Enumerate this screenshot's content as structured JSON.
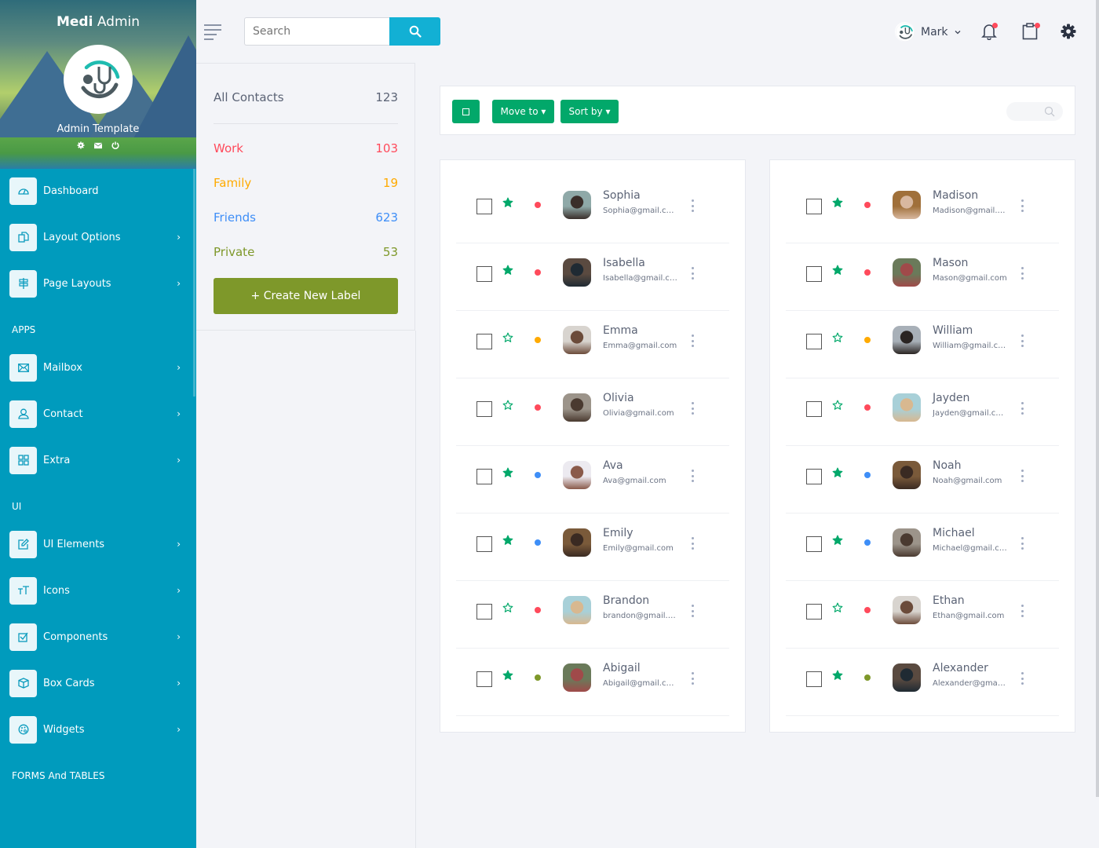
{
  "brand": {
    "bold": "Medi",
    "light": "Admin",
    "subtitle": "Admin Template"
  },
  "sidebar": {
    "header_icons": [
      "gear-icon",
      "mail-icon",
      "power-icon"
    ],
    "items": [
      {
        "label": "Dashboard",
        "icon": "speedometer-icon",
        "chevron": ""
      },
      {
        "label": "Layout Options",
        "icon": "copy-icon",
        "chevron": "›"
      },
      {
        "label": "Page Layouts",
        "icon": "signpost-icon",
        "chevron": "›"
      },
      {
        "label": "Mailbox",
        "icon": "envelope-icon",
        "chevron": "›"
      },
      {
        "label": "Contact",
        "icon": "user-icon",
        "chevron": "›"
      },
      {
        "label": "Extra",
        "icon": "grid-icon",
        "chevron": "›"
      },
      {
        "label": "UI Elements",
        "icon": "edit-icon",
        "chevron": "›"
      },
      {
        "label": "Icons",
        "icon": "text-size-icon",
        "chevron": "›"
      },
      {
        "label": "Components",
        "icon": "checkbox-icon",
        "chevron": "›"
      },
      {
        "label": "Box Cards",
        "icon": "box-icon",
        "chevron": "›"
      },
      {
        "label": "Widgets",
        "icon": "palette-icon",
        "chevron": "›"
      }
    ],
    "sections": [
      "APPS",
      "UI",
      "FORMS And TABLES"
    ]
  },
  "topbar": {
    "search_placeholder": "Search",
    "user_name": "Mark",
    "user_chevron": "⌄"
  },
  "labels": {
    "all": {
      "label": "All Contacts",
      "count": "123",
      "color": "#5b6375"
    },
    "items": [
      {
        "label": "Work",
        "count": "103",
        "color": "#ff4a5b"
      },
      {
        "label": "Family",
        "count": "19",
        "color": "#ffaa00"
      },
      {
        "label": "Friends",
        "count": "623",
        "color": "#3e8ef7"
      },
      {
        "label": "Private",
        "count": "53",
        "color": "#7e982a"
      }
    ],
    "create_button": "+ Create New Label"
  },
  "toolbar": {
    "select_all_glyph": "☐",
    "move_to": "Move to ▾",
    "sort_by": "Sort by ▾"
  },
  "colors": {
    "accent": "#009bbd",
    "green": "#02a86a",
    "red": "#ff4a5b",
    "orange": "#ffaa00",
    "blue": "#3e8ef7",
    "olive": "#7e982a"
  },
  "contacts": {
    "left": [
      {
        "name": "Sophia",
        "email": "Sophia@gmail.com",
        "starred": true,
        "status": "red",
        "avatar": [
          "#8fa9a8",
          "#3a2e2a"
        ]
      },
      {
        "name": "Isabella",
        "email": "Isabella@gmail.com",
        "starred": true,
        "status": "red",
        "avatar": [
          "#5a4a40",
          "#1f2a33"
        ]
      },
      {
        "name": "Emma",
        "email": "Emma@gmail.com",
        "starred": false,
        "status": "orange",
        "avatar": [
          "#d8d4cf",
          "#6b4b3a"
        ]
      },
      {
        "name": "Olivia",
        "email": "Olivia@gmail.com",
        "starred": false,
        "status": "red",
        "avatar": [
          "#9c948a",
          "#4a3a30"
        ]
      },
      {
        "name": "Ava",
        "email": "Ava@gmail.com",
        "starred": true,
        "status": "blue",
        "avatar": [
          "#eceaf0",
          "#8a5a4a"
        ]
      },
      {
        "name": "Emily",
        "email": "Emily@gmail.com",
        "starred": true,
        "status": "blue",
        "avatar": [
          "#7a5a3a",
          "#3a2a22"
        ]
      },
      {
        "name": "Brandon",
        "email": "brandon@gmail.com",
        "starred": false,
        "status": "red",
        "avatar": [
          "#a8d0d8",
          "#d8b890"
        ]
      },
      {
        "name": "Abigail",
        "email": "Abigail@gmail.com",
        "starred": true,
        "status": "olive",
        "avatar": [
          "#6a7a5a",
          "#a04a4a"
        ]
      }
    ],
    "right": [
      {
        "name": "Madison",
        "email": "Madison@gmail.com",
        "starred": true,
        "status": "red",
        "avatar": [
          "#a0703a",
          "#d8b8a0"
        ]
      },
      {
        "name": "Mason",
        "email": "Mason@gmail.com",
        "starred": true,
        "status": "red",
        "avatar": [
          "#6a7a5a",
          "#a04a4a"
        ]
      },
      {
        "name": "William",
        "email": "William@gmail.com",
        "starred": false,
        "status": "orange",
        "avatar": [
          "#a8b0b8",
          "#2a2422"
        ]
      },
      {
        "name": "Jayden",
        "email": "Jayden@gmail.com",
        "starred": false,
        "status": "red",
        "avatar": [
          "#a8d0d8",
          "#d8b890"
        ]
      },
      {
        "name": "Noah",
        "email": "Noah@gmail.com",
        "starred": true,
        "status": "blue",
        "avatar": [
          "#7a5a3a",
          "#3a2a22"
        ]
      },
      {
        "name": "Michael",
        "email": "Michael@gmail.com",
        "starred": true,
        "status": "blue",
        "avatar": [
          "#9c948a",
          "#4a3a30"
        ]
      },
      {
        "name": "Ethan",
        "email": "Ethan@gmail.com",
        "starred": false,
        "status": "red",
        "avatar": [
          "#d8d4cf",
          "#6b4b3a"
        ]
      },
      {
        "name": "Alexander",
        "email": "Alexander@gmail.com",
        "starred": true,
        "status": "olive",
        "avatar": [
          "#5a4a40",
          "#1f2a33"
        ]
      }
    ]
  }
}
